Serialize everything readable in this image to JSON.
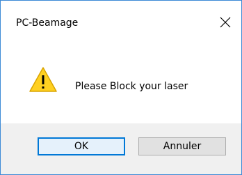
{
  "window": {
    "title": "PC-Beamage",
    "close_icon": "close-icon"
  },
  "dialog": {
    "icon": "warning-icon",
    "message": "Please Block your laser"
  },
  "buttons": {
    "ok_label": "OK",
    "cancel_label": "Annuler"
  },
  "colors": {
    "warning_fill": "#ffd021",
    "accent_border": "#0078d7",
    "window_border": "#3c8ad6"
  }
}
